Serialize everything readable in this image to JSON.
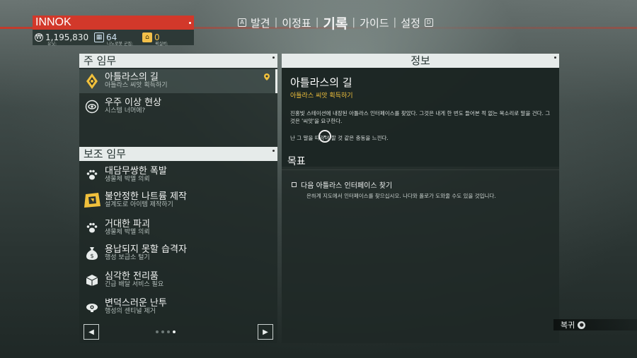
{
  "player": {
    "name": "INNOK",
    "units_value": "1,195,830",
    "units_label": "유닛:",
    "nanites_value": "64",
    "nanites_label": "나노로봇 군집:",
    "quicksilver_value": "0",
    "quicksilver_label": "퀵실버:"
  },
  "nav": {
    "left_key": "A",
    "right_key": "D",
    "tabs": [
      {
        "label": "발견"
      },
      {
        "label": "이정표"
      },
      {
        "label": "기록"
      },
      {
        "label": "가이드"
      },
      {
        "label": "설정"
      }
    ],
    "active_index": 2
  },
  "main_missions": {
    "header": "주 임무",
    "items": [
      {
        "title": "아틀라스의 길",
        "subtitle": "아틀라스 씨앗 획득하기",
        "icon": "atlas-icon"
      },
      {
        "title": "우주 이상 현상",
        "subtitle": "시스템 너머에?",
        "icon": "anomaly-icon"
      }
    ]
  },
  "side_missions": {
    "header": "보조 임무",
    "items": [
      {
        "title": "대담무쌍한 폭발",
        "subtitle": "생물체 박멸 의뢰",
        "icon": "paw-icon"
      },
      {
        "title": "불안정한 나트륨 제작",
        "subtitle": "설계도로 아이템 제작하기",
        "icon": "blueprint-icon"
      },
      {
        "title": "거대한 파괴",
        "subtitle": "생물체 박멸 의뢰",
        "icon": "paw-icon"
      },
      {
        "title": "용납되지 못할 습격자",
        "subtitle": "행성 보급소 털기",
        "icon": "money-bag-icon"
      },
      {
        "title": "심각한 전리품",
        "subtitle": "긴급 배달 서비스 필요",
        "icon": "package-icon"
      },
      {
        "title": "변덕스러운 난투",
        "subtitle": "행성의 센티널 제거",
        "icon": "sentinel-icon"
      }
    ]
  },
  "pager": {
    "page_count": 4,
    "active_page": 3
  },
  "info": {
    "header": "정보",
    "title": "아틀라스의 길",
    "subtitle": "아틀라스 씨앗 획득하기",
    "description": "진홍빛 스테이션에 내장된 아틀라스 인터페이스를 찾았다. 그것은 내게 한 번도 들어본 적 없는 목소리로 말을 건다. 그것은 '씨앗'을 요구한다.",
    "description2": "난 그 말을 따라야 할 것 같은 충동을 느낀다.",
    "goals_label": "목표",
    "goal_title": "다음 아틀라스 인터페이스 찾기",
    "goal_desc": "은하계 지도에서 인터페이스를 찾으십시오. 나다와 폴로가 도와줄 수도 있을 것입니다."
  },
  "return_label": "복귀",
  "colors": {
    "accent_red": "#d2382a",
    "accent_gold": "#f0c03c"
  }
}
